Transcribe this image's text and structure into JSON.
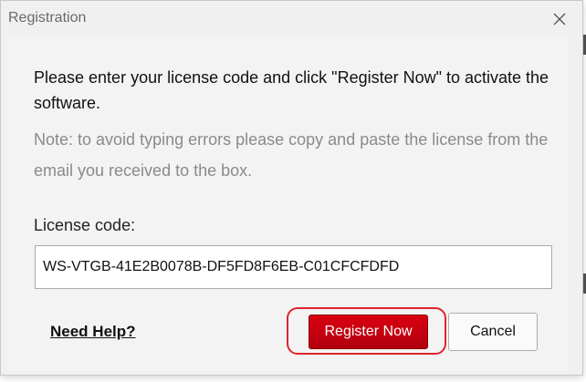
{
  "window": {
    "title": "Registration",
    "close_icon": "close-icon"
  },
  "dialog": {
    "message": "Please enter your license code and click \"Register Now\" to activate the software.",
    "note": "Note: to avoid typing errors please copy and paste the license from the email you received to the box.",
    "license_label": "License code:",
    "license_value": "WS-VTGB-41E2B0078B-DF5FD8F6EB-C01CFCFDFD",
    "help_label": "Need Help?",
    "register_label": "Register Now",
    "cancel_label": "Cancel"
  },
  "colors": {
    "dialog_bg": "#f0f0f0",
    "register_bg": "#c20010",
    "highlight": "#e0242c",
    "note_text": "#8a8a8a"
  }
}
